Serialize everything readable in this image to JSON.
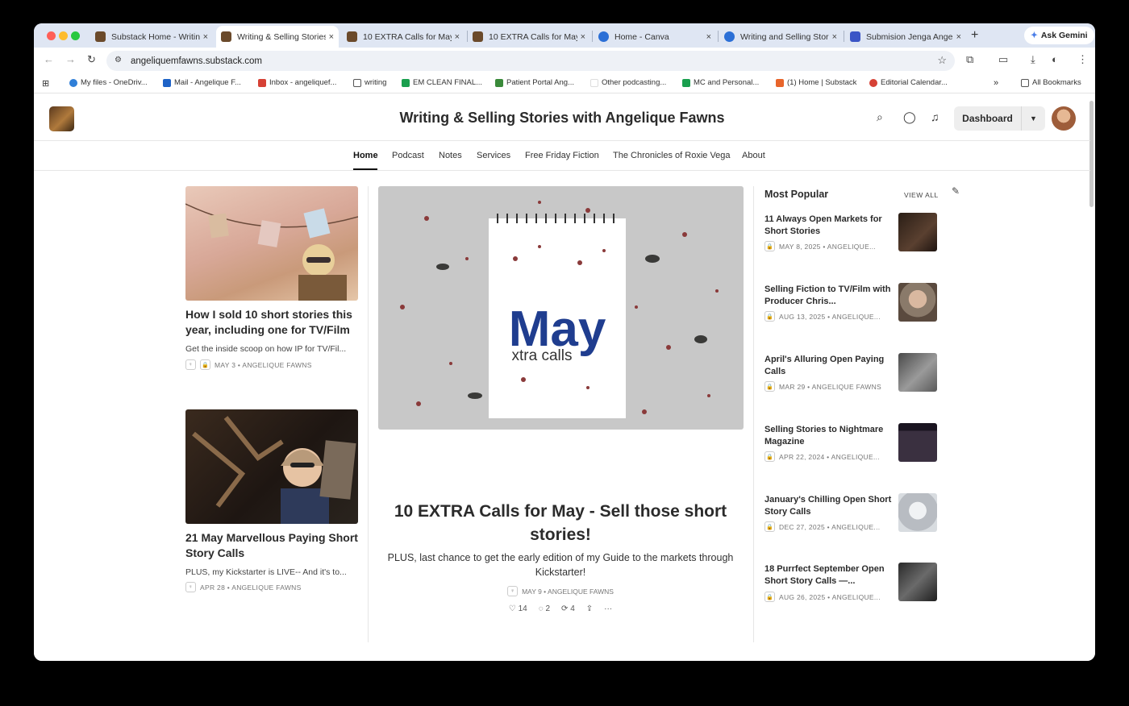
{
  "browser": {
    "tabs": [
      {
        "title": "Substack Home - Writing",
        "color": "#6b4a2b",
        "active": false
      },
      {
        "title": "Writing & Selling Stories",
        "color": "#6b4a2b",
        "active": true
      },
      {
        "title": "10 EXTRA Calls for May",
        "color": "#6b4a2b",
        "active": false
      },
      {
        "title": "10 EXTRA Calls for May",
        "color": "#6b4a2b",
        "active": false
      },
      {
        "title": "Home - Canva",
        "color": "#2b6fd6",
        "active": false
      },
      {
        "title": "Writing and Selling Stories",
        "color": "#2b6fd6",
        "active": false
      },
      {
        "title": "Submision Jenga Angelique",
        "color": "#3b55c6",
        "active": false
      }
    ],
    "tab_close": "×",
    "new_tab": "+",
    "gemini_label": "Ask Gemini",
    "url": "angeliquemfawns.substack.com",
    "bookmarks": [
      {
        "label": "My files - OneDriv...",
        "color": "#2f7fd8"
      },
      {
        "label": "Mail - Angelique F...",
        "color": "#1e63c7"
      },
      {
        "label": "Inbox - angeliquef...",
        "color": "#d64135"
      },
      {
        "label": "writing",
        "color": "#ffffff"
      },
      {
        "label": "EM CLEAN FINAL...",
        "color": "#1a9f4e"
      },
      {
        "label": "Patient Portal Ang...",
        "color": "#3a8a3a"
      },
      {
        "label": "Other podcasting...",
        "color": "#ffffff"
      },
      {
        "label": "MC and Personal...",
        "color": "#1a9f4e"
      },
      {
        "label": "(1) Home | Substack",
        "color": "#e8652b"
      },
      {
        "label": "Editorial Calendar...",
        "color": "#d64135"
      }
    ],
    "bookmarks_more": "»",
    "all_bookmarks": "All Bookmarks"
  },
  "site": {
    "title": "Writing & Selling Stories with Angelique Fawns",
    "dashboard_label": "Dashboard",
    "nav": [
      "Home",
      "Podcast",
      "Notes",
      "Services",
      "Free Friday Fiction",
      "The Chronicles of Roxie Vega",
      "About"
    ]
  },
  "left_posts": [
    {
      "title": "How I sold 10 short stories this year, including one for TV/Film",
      "subtitle": "Get the inside scoop on how IP for TV/Fil...",
      "meta": "MAY 3 • ANGELIQUE FAWNS"
    },
    {
      "title": "21 May Marvellous Paying Short Story Calls",
      "subtitle": "PLUS, my Kickstarter is LIVE-- And it's to...",
      "meta": "APR 28 • ANGELIQUE FAWNS"
    }
  ],
  "featured": {
    "image_text_big": "May",
    "image_text_small": "xtra calls",
    "title": "10 EXTRA Calls for May - Sell those short stories!",
    "subtitle": "PLUS, last chance to get the early edition of my Guide to the markets through Kickstarter!",
    "meta": "MAY 9 • ANGELIQUE FAWNS",
    "likes": "14",
    "comments": "2",
    "restacks": "4"
  },
  "popular": {
    "heading": "Most Popular",
    "view_all": "VIEW ALL",
    "items": [
      {
        "title": "11 Always Open Markets for Short Stories",
        "meta": "MAY 8, 2025 • ANGELIQUE...",
        "color": "#3a2a20"
      },
      {
        "title": "Selling Fiction to TV/Film with Producer Chris...",
        "meta": "AUG 13, 2025 • ANGELIQUE...",
        "color": "#8a7a6a"
      },
      {
        "title": "April's Alluring Open Paying Calls",
        "meta": "MAR 29 • ANGELIQUE FAWNS",
        "color": "#6a6a6a"
      },
      {
        "title": "Selling Stories to Nightmare Magazine",
        "meta": "APR 22, 2024 • ANGELIQUE...",
        "color": "#2a2030"
      },
      {
        "title": "January's Chilling Open Short Story Calls",
        "meta": "DEC 27, 2025 • ANGELIQUE...",
        "color": "#c8ccd0"
      },
      {
        "title": "18 Purrfect September Open Short Story Calls —...",
        "meta": "AUG 26, 2025 • ANGELIQUE...",
        "color": "#3a3a3a"
      }
    ]
  }
}
